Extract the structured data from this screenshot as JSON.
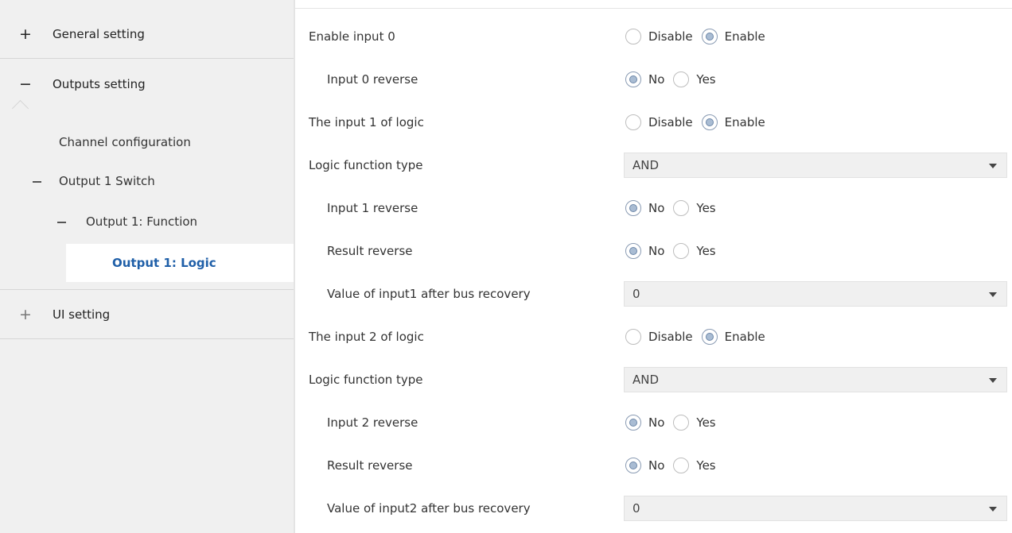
{
  "sidebar": {
    "general": {
      "sign": "+",
      "label": "General setting"
    },
    "outputs": {
      "sign": "−",
      "label": "Outputs setting"
    },
    "channel_configuration": "Channel configuration",
    "output1_switch": "Output 1 Switch",
    "output1_function": "Output 1: Function",
    "output1_logic": "Output 1: Logic",
    "ui": {
      "sign": "+",
      "label": "UI setting"
    }
  },
  "params": [
    {
      "label": "Enable input 0",
      "type": "radio",
      "options": [
        "Disable",
        "Enable"
      ],
      "selected": "Enable"
    },
    {
      "label": "Input 0 reverse",
      "type": "radio",
      "options": [
        "No",
        "Yes"
      ],
      "selected": "No"
    },
    {
      "label": "The input 1 of logic",
      "type": "radio",
      "options": [
        "Disable",
        "Enable"
      ],
      "selected": "Enable"
    },
    {
      "label": "Logic function type",
      "type": "select",
      "value": "AND"
    },
    {
      "label": "Input 1 reverse",
      "type": "radio",
      "options": [
        "No",
        "Yes"
      ],
      "selected": "No"
    },
    {
      "label": "Result reverse",
      "type": "radio",
      "options": [
        "No",
        "Yes"
      ],
      "selected": "No"
    },
    {
      "label": "Value of input1 after bus recovery",
      "type": "select",
      "value": "0"
    },
    {
      "label": "The input 2 of logic",
      "type": "radio",
      "options": [
        "Disable",
        "Enable"
      ],
      "selected": "Enable"
    },
    {
      "label": "Logic function type",
      "type": "select",
      "value": "AND"
    },
    {
      "label": "Input 2 reverse",
      "type": "radio",
      "options": [
        "No",
        "Yes"
      ],
      "selected": "No"
    },
    {
      "label": "Result reverse",
      "type": "radio",
      "options": [
        "No",
        "Yes"
      ],
      "selected": "No"
    },
    {
      "label": "Value of input2 after bus recovery",
      "type": "select",
      "value": "0"
    }
  ]
}
